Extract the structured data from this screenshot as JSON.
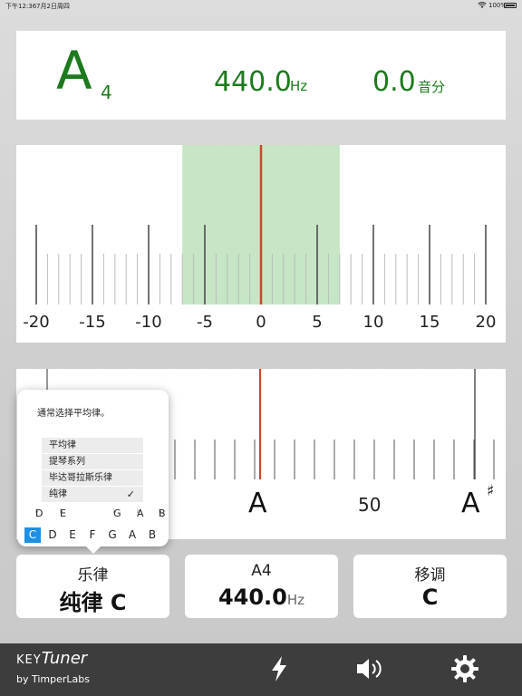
{
  "status_bar": {
    "time": "下午12:36",
    "date": "7月2日周四",
    "battery": "100%"
  },
  "readout": {
    "note": "A",
    "octave": "4",
    "frequency": "440.0",
    "frequency_unit": "Hz",
    "cents": "0.0",
    "cents_unit": "音分"
  },
  "meter": {
    "scale_labels": [
      "-20",
      "-15",
      "-10",
      "-5",
      "0",
      "5",
      "10",
      "15",
      "20"
    ],
    "needle_value": 0,
    "in_tune_range": [
      -7,
      7
    ],
    "accent": "#c6e6c6",
    "needle_color": "#d0462b"
  },
  "strobe": {
    "note_label": "A",
    "next_note_label": "A",
    "next_note_accidental": "♯",
    "mid_label": "50"
  },
  "temperament_popover": {
    "hint": "通常选择平均律。",
    "options": [
      "平均律",
      "提琴系列",
      "毕达哥拉斯乐律",
      "纯律"
    ],
    "selected": "纯律",
    "check": "✓",
    "flat_keys": [
      {
        "n": "D",
        "a": "♭"
      },
      {
        "n": "E",
        "a": "♭"
      },
      {
        "n": "G",
        "a": "♭"
      },
      {
        "n": "A",
        "a": "♭"
      },
      {
        "n": "B",
        "a": "♭"
      }
    ],
    "natural_keys": [
      "C",
      "D",
      "E",
      "F",
      "G",
      "A",
      "B"
    ],
    "selected_key": "C"
  },
  "buttons": {
    "temperament": {
      "label": "乐律",
      "value": "纯律 C"
    },
    "reference": {
      "label": "A4",
      "value": "440.0",
      "unit": "Hz"
    },
    "transpose": {
      "label": "移调",
      "value": "C"
    }
  },
  "brand": {
    "key": "KEY",
    "tuner": "Tuner",
    "by": "by TimperLabs"
  },
  "toolbar": {
    "icons": [
      "lightning-icon",
      "speaker-icon",
      "gear-icon"
    ]
  }
}
